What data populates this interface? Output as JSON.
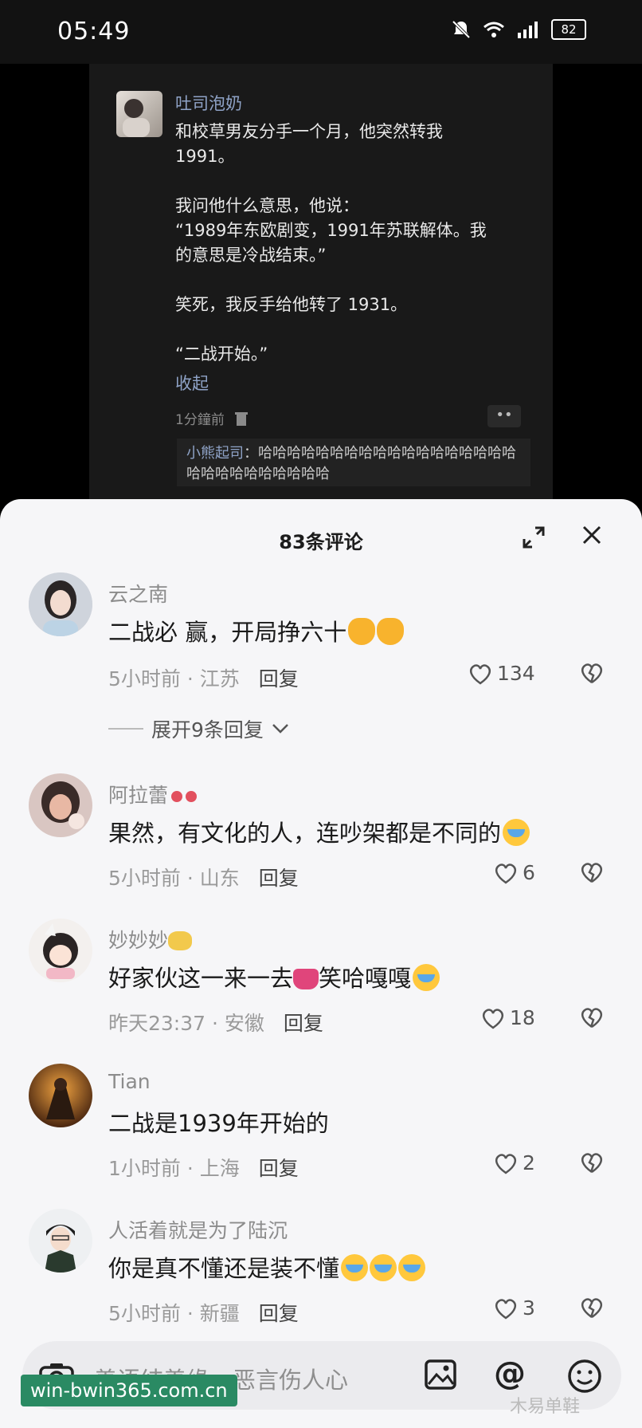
{
  "status_bar": {
    "time": "05:49",
    "battery": "82"
  },
  "post": {
    "author": "吐司泡奶",
    "text": "和校草男友分手一个月，他突然转我\n1991。\n\n我问他什么意思，他说：\n“1989年东欧剧变，1991年苏联解体。我\n的意思是冷战结束。”\n\n笑死，我反手给他转了 1931。\n\n“二战开始。”",
    "collapse_label": "收起",
    "time": "1分鐘前",
    "reply": {
      "name": "小熊起司",
      "text": "：哈哈哈哈哈哈哈哈哈哈哈哈哈哈哈哈哈哈哈哈哈哈哈哈哈哈哈哈"
    }
  },
  "sheet": {
    "title": "83条评论",
    "expand_replies_label": "展开9条回复",
    "reply_label": "回复"
  },
  "comments": [
    {
      "name": "云之南",
      "text": "二战必 赢，开局挣六十",
      "time": "5小时前",
      "location": "江苏",
      "likes": "134"
    },
    {
      "name": "阿拉蕾",
      "text": "果然，有文化的人，连吵架都是不同的",
      "time": "5小时前",
      "location": "山东",
      "likes": "6"
    },
    {
      "name": "妙妙妙",
      "text_a": "好家伙这一来一去",
      "text_b": "笑哈嘎嘎",
      "time": "昨天23:37",
      "location": "安徽",
      "likes": "18"
    },
    {
      "name": "Tian",
      "text": "二战是1939年开始的",
      "time": "1小时前",
      "location": "上海",
      "likes": "2"
    },
    {
      "name": "人活着就是为了陆沉",
      "text": "你是真不懂还是装不懂",
      "time": "5小时前",
      "location": "新疆",
      "likes": "3"
    }
  ],
  "input": {
    "placeholder": "善语结善缘，恶言伤人心"
  },
  "watermarks": {
    "left": "win-bwin365.com.cn",
    "right": "木易单鞋"
  }
}
